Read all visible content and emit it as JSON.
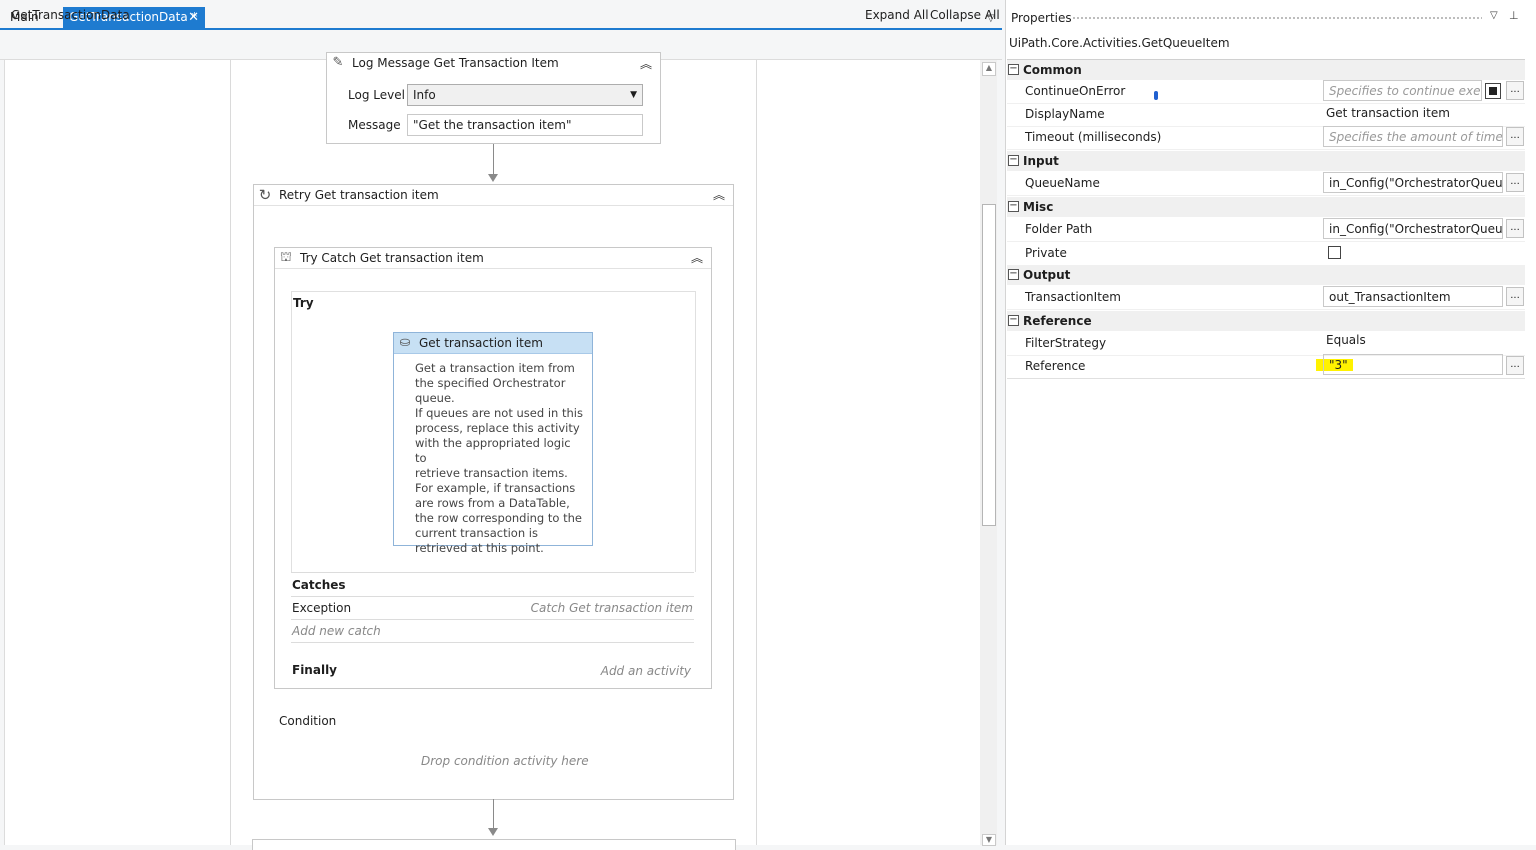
{
  "tabs": {
    "main": "Main",
    "active": "GetTransactionData *",
    "close": "✕"
  },
  "designer": {
    "breadcrumb": "GetTransactionData",
    "expand_all": "Expand All",
    "collapse_all": "Collapse All"
  },
  "log_message": {
    "title": "Log Message Get Transaction Item",
    "log_level_label": "Log Level",
    "log_level_value": "Info",
    "message_label": "Message",
    "message_value": "\"Get the transaction item\""
  },
  "retry": {
    "title": "Retry Get transaction item",
    "condition_label": "Condition",
    "drop_hint": "Drop condition activity here"
  },
  "try_catch": {
    "title": "Try Catch Get transaction item",
    "try_label": "Try",
    "catches_label": "Catches",
    "exception_label": "Exception",
    "exception_value": "Catch Get transaction item",
    "add_catch": "Add new catch",
    "finally_label": "Finally",
    "add_activity": "Add an activity"
  },
  "get_item": {
    "title": "Get transaction item",
    "description": [
      "Get a transaction item from",
      "the specified Orchestrator",
      "queue.",
      "If queues are not used in this",
      "process, replace this activity",
      "with the appropriated logic to",
      "retrieve transaction items.",
      "For example, if transactions",
      "are rows from a DataTable,",
      "the row corresponding to the",
      "current transaction is",
      "retrieved at this point."
    ]
  },
  "properties": {
    "title": "Properties",
    "type": "UiPath.Core.Activities.GetQueueItem",
    "sections": {
      "common": "Common",
      "input": "Input",
      "misc": "Misc",
      "output": "Output",
      "reference": "Reference"
    },
    "rows": {
      "continue_on_error": {
        "name": "ContinueOnError",
        "placeholder": "Specifies to continue executi"
      },
      "display_name": {
        "name": "DisplayName",
        "value": "Get transaction item"
      },
      "timeout": {
        "name": "Timeout (milliseconds)",
        "placeholder": "Specifies the amount of time (in r"
      },
      "queue_name": {
        "name": "QueueName",
        "value": "in_Config(\"OrchestratorQueueN"
      },
      "folder_path": {
        "name": "Folder Path",
        "value": "in_Config(\"OrchestratorQueueFc"
      },
      "private": {
        "name": "Private"
      },
      "transaction_item": {
        "name": "TransactionItem",
        "value": "out_TransactionItem"
      },
      "filter_strategy": {
        "name": "FilterStrategy",
        "value": "Equals"
      },
      "reference": {
        "name": "Reference",
        "value": "\"3\""
      }
    },
    "ellipsis": "..."
  },
  "icons": {
    "log": "log-message-icon",
    "retry": "retry-icon",
    "trycatch": "try-catch-icon",
    "queue": "queue-item-icon"
  },
  "colors": {
    "accent": "#1e7bd0",
    "selected_header": "#c7e0f4",
    "highlight": "#fff200"
  }
}
